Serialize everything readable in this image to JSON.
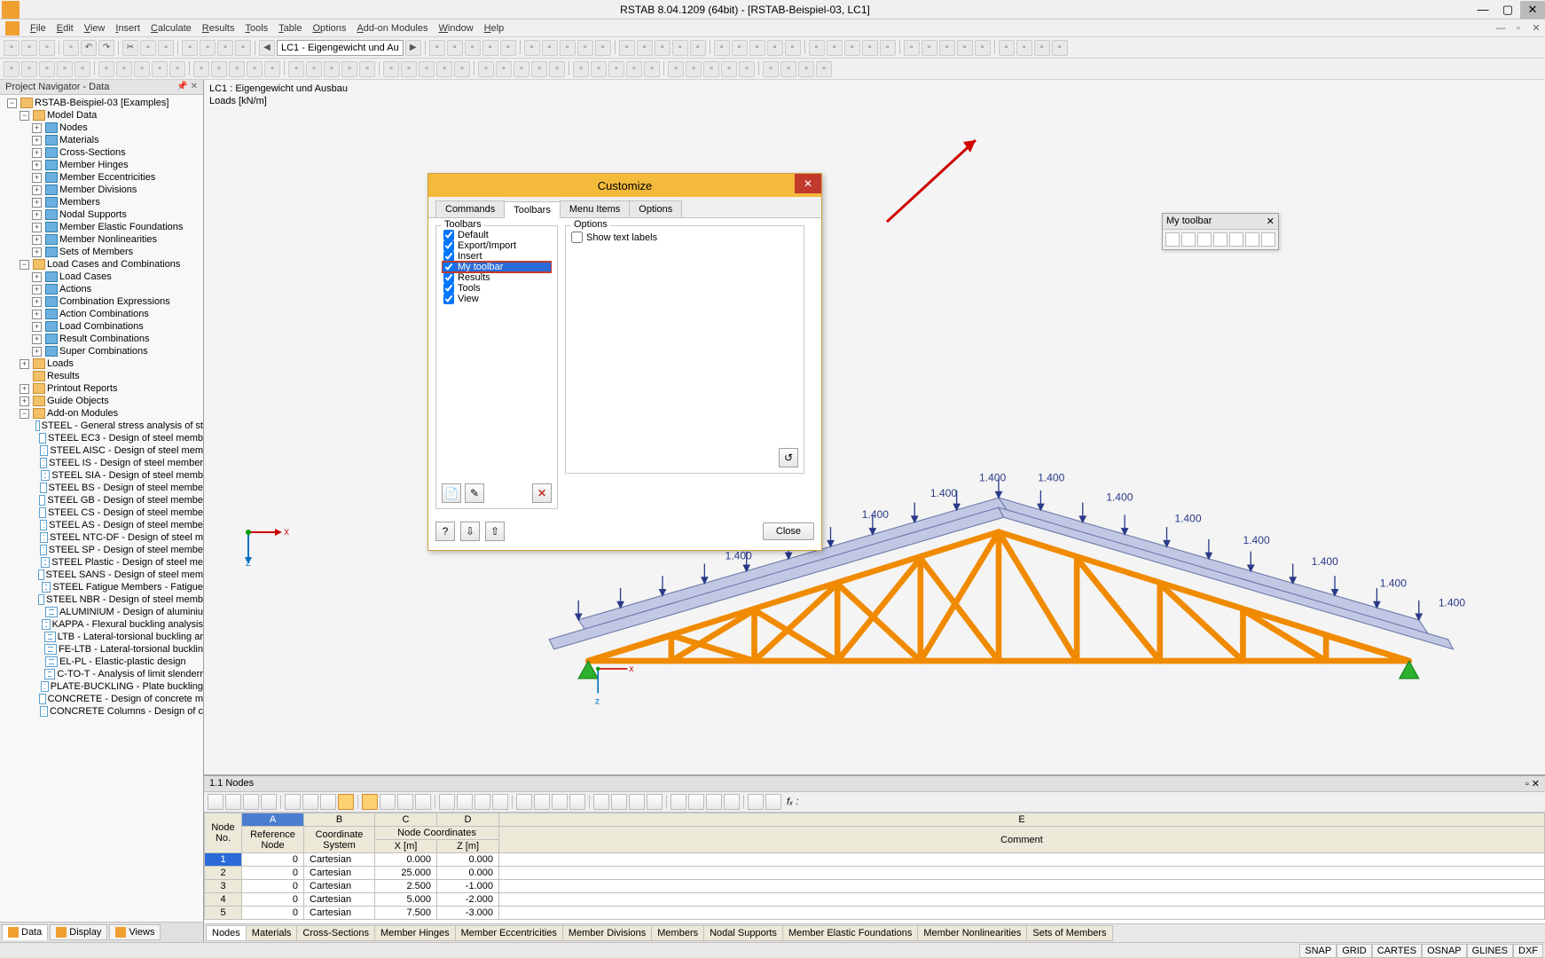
{
  "title": "RSTAB 8.04.1209 (64bit) - [RSTAB-Beispiel-03, LC1]",
  "menu": [
    "File",
    "Edit",
    "View",
    "Insert",
    "Calculate",
    "Results",
    "Tools",
    "Table",
    "Options",
    "Add-on Modules",
    "Window",
    "Help"
  ],
  "combo_lc": "LC1 - Eigengewicht und Au",
  "navigator": {
    "title": "Project Navigator - Data",
    "root": "RSTAB-Beispiel-03 [Examples]",
    "groups": {
      "model_data": {
        "label": "Model Data",
        "items": [
          "Nodes",
          "Materials",
          "Cross-Sections",
          "Member Hinges",
          "Member Eccentricities",
          "Member Divisions",
          "Members",
          "Nodal Supports",
          "Member Elastic Foundations",
          "Member Nonlinearities",
          "Sets of Members"
        ]
      },
      "lcc": {
        "label": "Load Cases and Combinations",
        "items": [
          "Load Cases",
          "Actions",
          "Combination Expressions",
          "Action Combinations",
          "Load Combinations",
          "Result Combinations",
          "Super Combinations"
        ]
      },
      "loads": "Loads",
      "results": "Results",
      "printout": "Printout Reports",
      "guide": "Guide Objects",
      "addons": {
        "label": "Add-on Modules",
        "items": [
          "STEEL - General stress analysis of st",
          "STEEL EC3 - Design of steel memb",
          "STEEL AISC - Design of steel mem",
          "STEEL IS - Design of steel member",
          "STEEL SIA - Design of steel memb",
          "STEEL BS - Design of steel membe",
          "STEEL GB - Design of steel membe",
          "STEEL CS - Design of steel membe",
          "STEEL AS - Design of steel membe",
          "STEEL NTC-DF - Design of steel m",
          "STEEL SP - Design of steel membe",
          "STEEL Plastic - Design of steel me",
          "STEEL SANS - Design of steel mem",
          "STEEL Fatigue Members - Fatigue",
          "STEEL NBR - Design of steel memb",
          "ALUMINIUM - Design of aluminiu",
          "KAPPA - Flexural buckling analysis",
          "LTB - Lateral-torsional buckling ar",
          "FE-LTB - Lateral-torsional bucklin",
          "EL-PL - Elastic-plastic design",
          "C-TO-T - Analysis of limit slenderr",
          "PLATE-BUCKLING - Plate buckling",
          "CONCRETE - Design of concrete m",
          "CONCRETE Columns - Design of c"
        ]
      }
    },
    "tabs": [
      "Data",
      "Display",
      "Views"
    ]
  },
  "viewport": {
    "caption1": "LC1 : Eigengewicht und Ausbau",
    "caption2": "Loads [kN/m]",
    "loads_label": "1.400"
  },
  "dialog": {
    "title": "Customize",
    "tabs": [
      "Commands",
      "Toolbars",
      "Menu Items",
      "Options"
    ],
    "active_tab": 1,
    "toolbars_legend": "Toolbars",
    "options_legend": "Options",
    "toolbars": [
      {
        "name": "Default",
        "checked": true
      },
      {
        "name": "Export/Import",
        "checked": true
      },
      {
        "name": "Insert",
        "checked": true
      },
      {
        "name": "My toolbar",
        "checked": true,
        "selected": true,
        "highlight": true
      },
      {
        "name": "Results",
        "checked": true
      },
      {
        "name": "Tools",
        "checked": true
      },
      {
        "name": "View",
        "checked": true
      }
    ],
    "opt_show_text": "Show text labels",
    "close": "Close"
  },
  "float_toolbar": {
    "title": "My toolbar"
  },
  "bottom": {
    "title": "1.1 Nodes",
    "headers_row1": {
      "node_no": "Node",
      "ref_node": "Reference",
      "coord_sys": "Coordinate",
      "coords": "Node Coordinates",
      "comment": "Comment"
    },
    "headers_row2": {
      "node_no": "No.",
      "ref_node": "Node",
      "coord_sys": "System",
      "x": "X [m]",
      "z": "Z [m]"
    },
    "col_letters": [
      "A",
      "B",
      "C",
      "D",
      "E"
    ],
    "rows": [
      {
        "no": "1",
        "ref": "0",
        "sys": "Cartesian",
        "x": "0.000",
        "z": "0.000",
        "c": ""
      },
      {
        "no": "2",
        "ref": "0",
        "sys": "Cartesian",
        "x": "25.000",
        "z": "0.000",
        "c": ""
      },
      {
        "no": "3",
        "ref": "0",
        "sys": "Cartesian",
        "x": "2.500",
        "z": "-1.000",
        "c": ""
      },
      {
        "no": "4",
        "ref": "0",
        "sys": "Cartesian",
        "x": "5.000",
        "z": "-2.000",
        "c": ""
      },
      {
        "no": "5",
        "ref": "0",
        "sys": "Cartesian",
        "x": "7.500",
        "z": "-3.000",
        "c": ""
      }
    ],
    "tabs": [
      "Nodes",
      "Materials",
      "Cross-Sections",
      "Member Hinges",
      "Member Eccentricities",
      "Member Divisions",
      "Members",
      "Nodal Supports",
      "Member Elastic Foundations",
      "Member Nonlinearities",
      "Sets of Members"
    ],
    "fx_label": "fₓ :"
  },
  "status": [
    "SNAP",
    "GRID",
    "CARTES",
    "OSNAP",
    "GLINES",
    "DXF"
  ]
}
